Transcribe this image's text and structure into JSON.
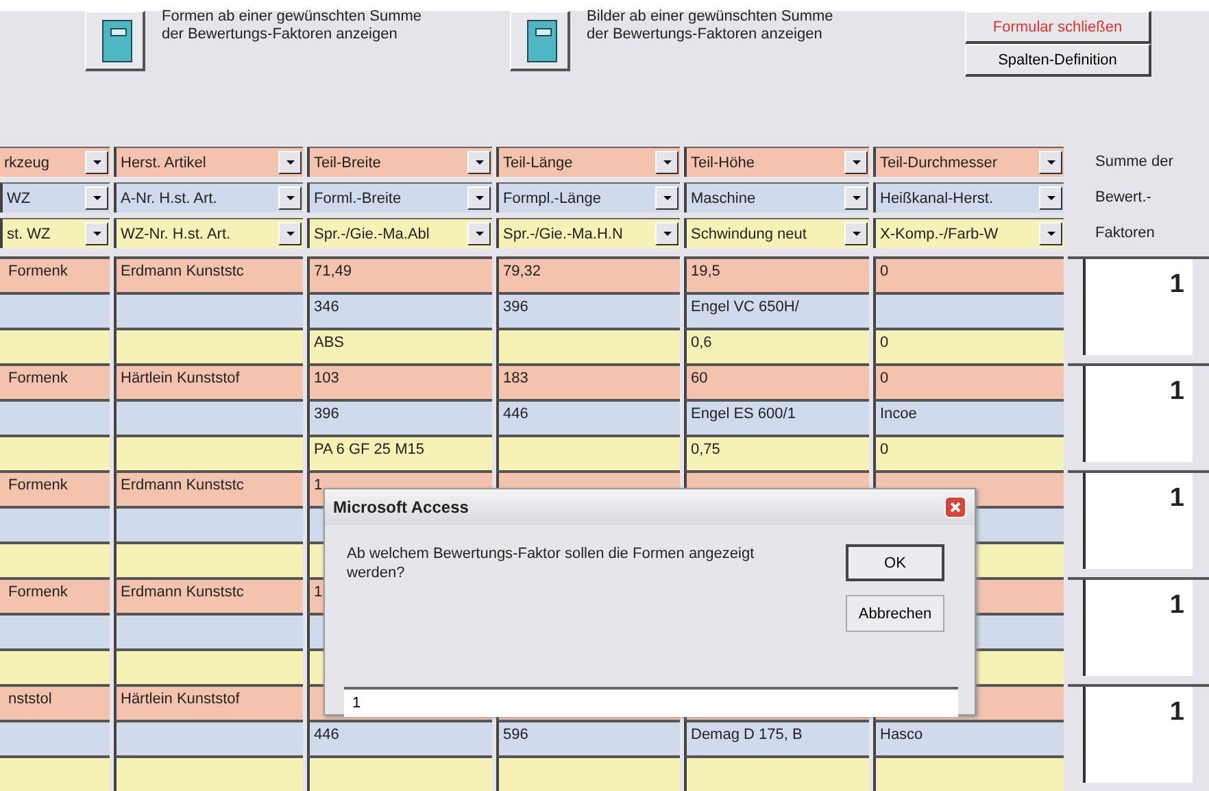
{
  "toolbar": {
    "actions": [
      {
        "label": "Formen ab einer gewünschten Summe der Bewertungs-Faktoren anzeigen"
      },
      {
        "label": "Bilder ab einer gewünschten Summe der Bewertungs-Faktoren anzeigen"
      }
    ],
    "buttons": [
      {
        "label": "Formular schließen",
        "kind": "danger"
      },
      {
        "label": "Spalten-Definition",
        "kind": "normal"
      }
    ]
  },
  "filters": [
    {
      "cells": [
        "rkzeug",
        "Herst. Artikel",
        "Teil-Breite",
        "Teil-Länge",
        "Teil-Höhe",
        "Teil-Durchmesser"
      ],
      "sum_label": "Summe der"
    },
    {
      "cells": [
        "WZ",
        "A-Nr. H.st. Art.",
        "Forml.-Breite",
        "Formpl.-Länge",
        "Maschine",
        "Heißkanal-Herst."
      ],
      "sum_label": "Bewert.-"
    },
    {
      "cells": [
        "st. WZ",
        "WZ-Nr. H.st. Art.",
        "Spr.-/Gie.-Ma.Abl",
        "Spr.-/Gie.-Ma.H.N",
        "Schwindung neut",
        "X-Komp.-/Farb-W"
      ],
      "sum_label": "Faktoren"
    }
  ],
  "records": [
    {
      "sum": "1",
      "rows": [
        [
          "Formenk",
          "Erdmann Kunststc",
          "71,49",
          "79,32",
          "19,5",
          "0"
        ],
        [
          "",
          "",
          "346",
          "396",
          "Engel VC   650H/",
          ""
        ],
        [
          "",
          "",
          "ABS",
          "",
          "0,6",
          "0"
        ]
      ]
    },
    {
      "sum": "1",
      "rows": [
        [
          "Formenk",
          "Härtlein Kunststof",
          "103",
          "183",
          "60",
          "0"
        ],
        [
          "",
          "",
          "396",
          "446",
          "Engel ES   600/1",
          "Incoe"
        ],
        [
          "",
          "",
          "PA 6 GF 25 M15",
          "",
          "0,75",
          "0"
        ]
      ]
    },
    {
      "sum": "1",
      "rows": [
        [
          "Formenk",
          "Erdmann Kunststc",
          "1",
          "",
          "",
          ""
        ],
        [
          "",
          "",
          "",
          null,
          null,
          ""
        ],
        [
          "",
          "",
          "",
          null,
          null,
          ""
        ]
      ]
    },
    {
      "sum": "1",
      "rows": [
        [
          "Formenk",
          "Erdmann Kunststc",
          "1",
          null,
          null,
          ""
        ],
        [
          "",
          "",
          "",
          null,
          null,
          ""
        ],
        [
          "",
          "",
          "",
          null,
          null,
          ""
        ]
      ]
    },
    {
      "sum": "1",
      "rows": [
        [
          "nststol",
          "Härtlein Kunststof",
          "",
          "",
          "",
          ""
        ],
        [
          "",
          "",
          "446",
          "596",
          "Demag D  175, B",
          "Hasco"
        ],
        [
          "",
          "",
          "",
          "",
          "",
          ""
        ]
      ]
    }
  ],
  "dialog": {
    "title": "Microsoft Access",
    "message": "Ab welchem Bewertungs-Faktor sollen die Formen angezeigt werden?",
    "buttons": [
      "OK",
      "Abbrechen"
    ],
    "value": "1"
  }
}
